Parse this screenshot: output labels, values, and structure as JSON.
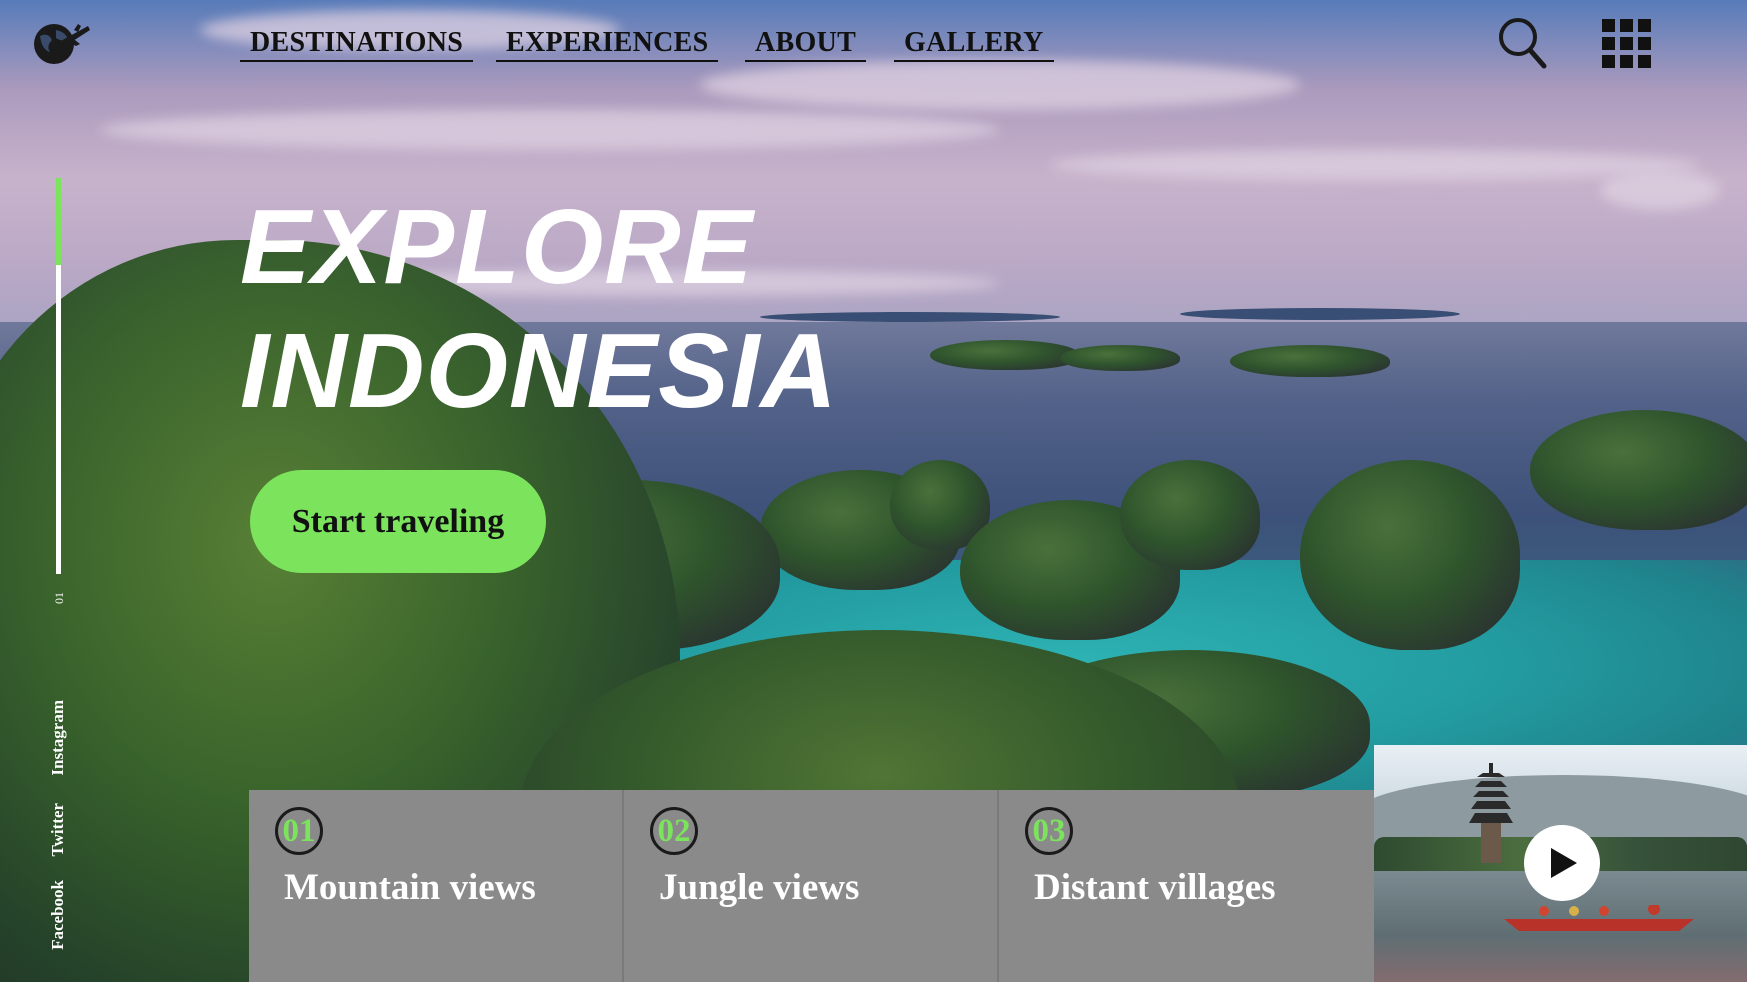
{
  "nav": {
    "links": [
      {
        "label": "DESTINATIONS"
      },
      {
        "label": "EXPERIENCES"
      },
      {
        "label": "ABOUT"
      },
      {
        "label": "GALLERY"
      }
    ]
  },
  "header": {
    "logo_icon": "globe-airplane-icon",
    "search_icon": "search-icon",
    "menu_icon": "grid-menu-icon"
  },
  "hero": {
    "title_line1": "EXPLORE",
    "title_line2": "INDONESIA",
    "cta_label": "Start traveling"
  },
  "slider": {
    "current": "01",
    "progress_fraction": 0.22
  },
  "social": {
    "links": [
      {
        "label": "Instagram"
      },
      {
        "label": "Twitter"
      },
      {
        "label": "Facebook"
      }
    ]
  },
  "features": [
    {
      "number": "01",
      "title": "Mountain views"
    },
    {
      "number": "02",
      "title": "Jungle views"
    },
    {
      "number": "03",
      "title": "Distant villages"
    }
  ],
  "video": {
    "play_icon": "play-icon"
  },
  "colors": {
    "accent": "#7be35c",
    "card_bg": "#8a8a8a",
    "text_dark": "#111111",
    "text_light": "#ffffff"
  }
}
